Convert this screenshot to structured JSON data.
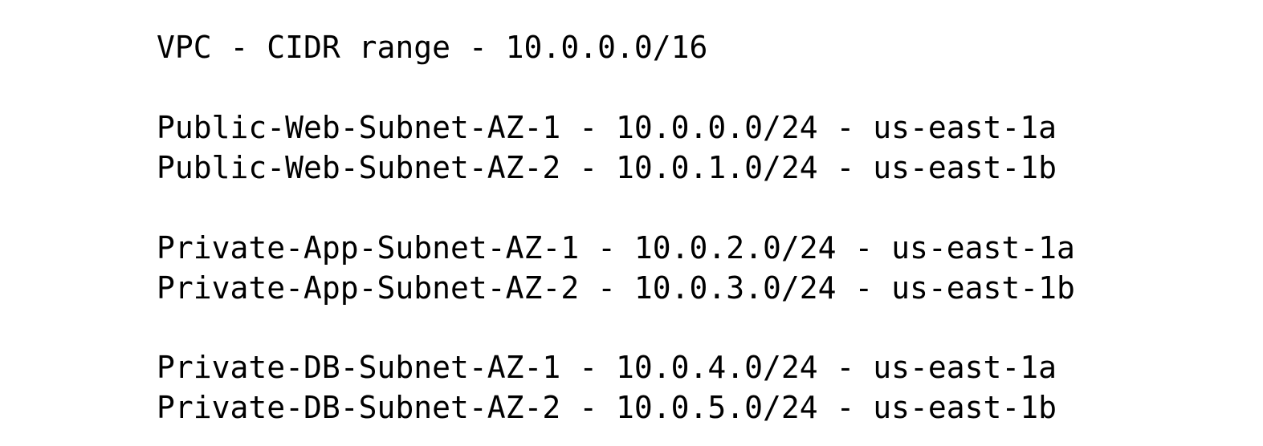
{
  "vpc": {
    "text": "VPC - CIDR range - 10.0.0.0/16"
  },
  "subnet_groups": [
    {
      "lines": [
        "Public-Web-Subnet-AZ-1 - 10.0.0.0/24 - us-east-1a",
        "Public-Web-Subnet-AZ-2 - 10.0.1.0/24 - us-east-1b"
      ]
    },
    {
      "lines": [
        "Private-App-Subnet-AZ-1 - 10.0.2.0/24 - us-east-1a",
        "Private-App-Subnet-AZ-2 - 10.0.3.0/24 - us-east-1b"
      ]
    },
    {
      "lines": [
        "Private-DB-Subnet-AZ-1 - 10.0.4.0/24 - us-east-1a",
        "Private-DB-Subnet-AZ-2 - 10.0.5.0/24 - us-east-1b"
      ]
    }
  ]
}
